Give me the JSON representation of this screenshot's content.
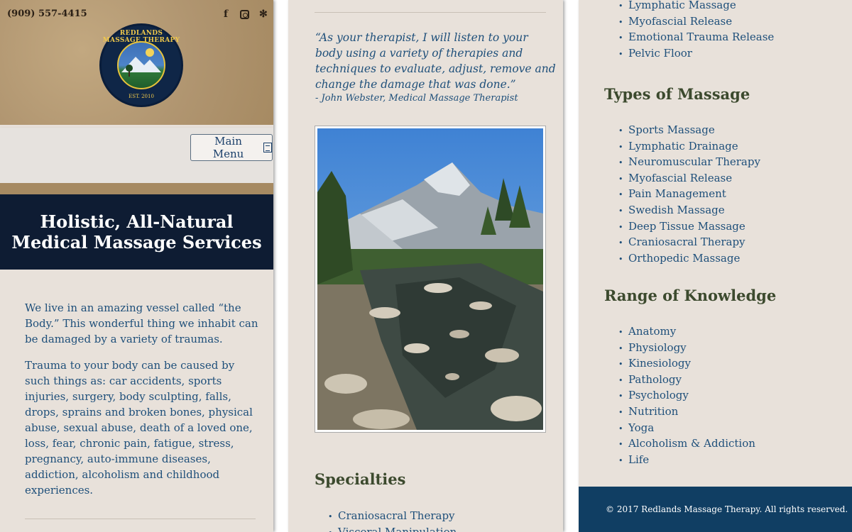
{
  "header": {
    "phone": "(909) 557-4415",
    "social_icons": [
      "facebook-icon",
      "instagram-icon",
      "yelp-icon"
    ],
    "facebook_glyph": "f",
    "yelp_glyph": "✻",
    "logo_text": "REDLANDS MASSAGE THERAPY",
    "logo_est": "EST. 2010"
  },
  "nav": {
    "menu_label": "Main Menu"
  },
  "hero": {
    "line1": "Holistic, All-Natural",
    "line2": "Medical Massage Services"
  },
  "intro": {
    "paragraph1": "We live in an amazing vessel called “the Body.” This wonderful thing we inhabit can be damaged by a variety of traumas.",
    "paragraph2": "Trauma to your body can be caused by such things as: car accidents, sports injuries, surgery, body sculpting, falls, drops, sprains and broken bones, physical abuse, sexual abuse, death of a loved one, loss, fear, chronic pain, fatigue, stress, pregnancy, auto-immune diseases, addiction, alcoholism and childhood experiences."
  },
  "quote": {
    "text": "“As your therapist, I will listen to your body using a variety of therapies and techniques to evaluate, adjust, remove and change the damage that was done.”",
    "author": "- John Webster, Medical Massage Therapist"
  },
  "specialties": {
    "heading": "Specialties",
    "items_visible_panel2": [
      "Craniosacral Therapy",
      "Visceral Manipulation"
    ],
    "items_visible_panel3": [
      "Lymphatic Massage",
      "Myofascial Release",
      "Emotional Trauma Release",
      "Pelvic Floor"
    ]
  },
  "types": {
    "heading": "Types of Massage",
    "items": [
      "Sports Massage",
      "Lymphatic Drainage",
      "Neuromuscular Therapy",
      "Myofascial Release",
      "Pain Management",
      "Swedish Massage",
      "Deep Tissue Massage",
      "Craniosacral Therapy",
      "Orthopedic Massage"
    ]
  },
  "knowledge": {
    "heading": "Range of Knowledge",
    "items": [
      "Anatomy",
      "Physiology",
      "Kinesiology",
      "Pathology",
      "Psychology",
      "Nutrition",
      "Yoga",
      "Alcoholism & Addiction",
      "Life"
    ]
  },
  "footer": {
    "copyright": "© 2017 Redlands Massage Therapy. All rights reserved."
  }
}
